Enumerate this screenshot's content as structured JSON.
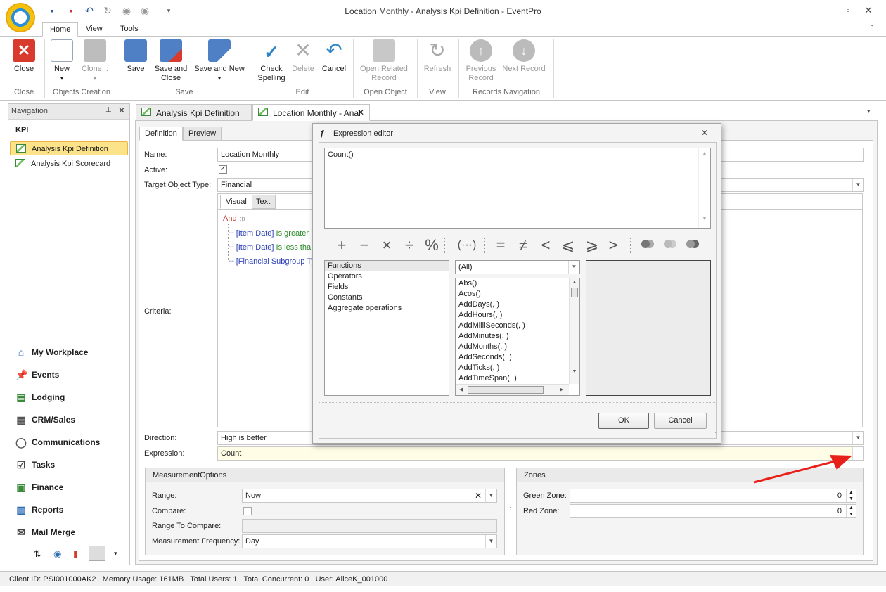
{
  "window": {
    "title": "Location Monthly - Analysis Kpi Definition - EventPro"
  },
  "ribbon_tabs": [
    "Home",
    "View",
    "Tools"
  ],
  "ribbon": {
    "buttons": [
      {
        "label": "Close",
        "group": "Close"
      },
      {
        "label": "New",
        "group": "Objects Creation"
      },
      {
        "label": "Clone...",
        "group": "Objects Creation"
      },
      {
        "label": "Save",
        "group": "Save"
      },
      {
        "label": "Save and Close",
        "group": "Save"
      },
      {
        "label": "Save and New",
        "group": "Save"
      },
      {
        "label": "Check Spelling",
        "group": "Edit"
      },
      {
        "label": "Delete",
        "group": "Edit"
      },
      {
        "label": "Cancel",
        "group": "Edit"
      },
      {
        "label": "Open Related Record",
        "group": "Open Object"
      },
      {
        "label": "Refresh",
        "group": "View"
      },
      {
        "label": "Previous Record",
        "group": "Records Navigation"
      },
      {
        "label": "Next Record",
        "group": "Records Navigation"
      }
    ],
    "groups": [
      "Close",
      "Objects Creation",
      "Save",
      "Edit",
      "Open Object",
      "View",
      "Records Navigation"
    ]
  },
  "navigation": {
    "title": "Navigation",
    "section": "KPI",
    "items": [
      "Analysis Kpi Definition",
      "Analysis Kpi Scorecard"
    ],
    "modules": [
      "My Workplace",
      "Events",
      "Lodging",
      "CRM/Sales",
      "Communications",
      "Tasks",
      "Finance",
      "Reports",
      "Mail Merge"
    ]
  },
  "doc_tabs": [
    "Analysis Kpi Definition",
    "Location Monthly - Anal"
  ],
  "sub_tabs": [
    "Definition",
    "Preview"
  ],
  "form": {
    "name_label": "Name:",
    "name_value": "Location Monthly",
    "active_label": "Active:",
    "target_label": "Target Object Type:",
    "target_value": "Financial",
    "criteria_label": "Criteria:",
    "criteria_tabs": [
      "Visual",
      "Text"
    ],
    "criteria_root": "And",
    "criteria_lines": [
      {
        "field": "[Item Date]",
        "op": "Is greater"
      },
      {
        "field": "[Item Date]",
        "op": "Is less tha"
      },
      {
        "field": "[Financial Subgroup Ty",
        "op": ""
      }
    ],
    "direction_label": "Direction:",
    "direction_value": "High is better",
    "expression_label": "Expression:",
    "expression_value": "Count",
    "expression_button": "···"
  },
  "measurement": {
    "title": "MeasurementOptions",
    "range_label": "Range:",
    "range_value": "Now",
    "compare_label": "Compare:",
    "range_compare_label": "Range To Compare:",
    "frequency_label": "Measurement Frequency:",
    "frequency_value": "Day"
  },
  "zones": {
    "title": "Zones",
    "green_label": "Green Zone:",
    "green_value": "0",
    "red_label": "Red Zone:",
    "red_value": "0"
  },
  "dialog": {
    "title": "Expression editor",
    "expression_text": "Count()",
    "operators": [
      "+",
      "−",
      "×",
      "÷",
      "%",
      "(···)",
      "=",
      "≠",
      "<",
      "⩽",
      "⩾",
      ">"
    ],
    "categories": [
      "Functions",
      "Operators",
      "Fields",
      "Constants",
      "Aggregate operations"
    ],
    "filter_value": "(All)",
    "functions": [
      "Abs()",
      "Acos()",
      "AddDays(, )",
      "AddHours(, )",
      "AddMilliSeconds(, )",
      "AddMinutes(, )",
      "AddMonths(, )",
      "AddSeconds(, )",
      "AddTicks(, )",
      "AddTimeSpan(, )"
    ],
    "ok_label": "OK",
    "cancel_label": "Cancel"
  },
  "status": {
    "client_id": "Client ID: PSI001000AK2",
    "memory": "Memory Usage: 161MB",
    "total_users": "Total Users: 1",
    "total_concurrent": "Total Concurrent: 0",
    "user": "User: AliceK_001000"
  },
  "colors": {
    "accent": "#fce38a",
    "expression_field_bg": "#fffde6",
    "arrow": "#e8201a"
  }
}
